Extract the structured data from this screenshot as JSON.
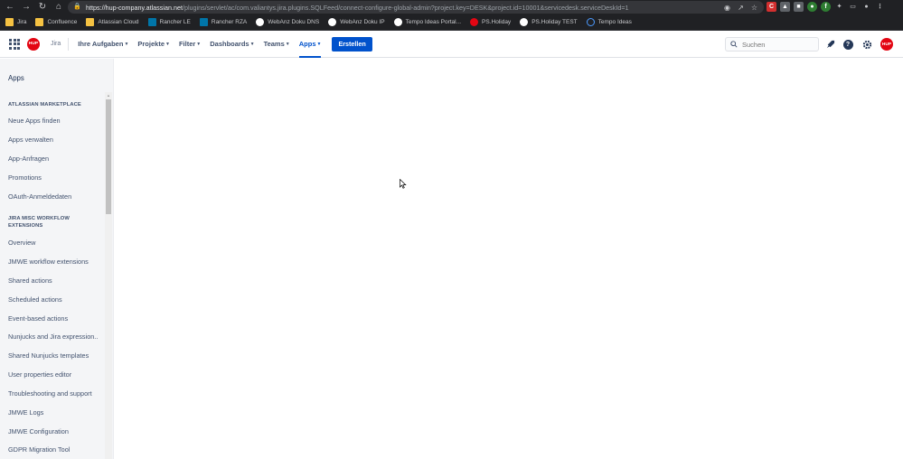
{
  "browser": {
    "url_host": "https://hup-company.atlassian.net",
    "url_path": "/plugins/servlet/ac/com.valiantys.jira.plugins.SQLFeed/connect-configure-global-admin?project.key=DESK&project.id=10001&servicedesk.serviceDeskId=1",
    "bookmarks": [
      {
        "label": "Jira",
        "icon": "folder-icon",
        "color": "#f5c242"
      },
      {
        "label": "Confluence",
        "icon": "folder-icon",
        "color": "#f5c242"
      },
      {
        "label": "Atlassian Cloud",
        "icon": "folder-icon",
        "color": "#f5c242"
      },
      {
        "label": "Rancher LE",
        "icon": "rancher-icon",
        "color": "#0075a8"
      },
      {
        "label": "Rancher RZA",
        "icon": "rancher-icon",
        "color": "#0075a8"
      },
      {
        "label": "WebAnz Doku DNS",
        "icon": "github-icon",
        "color": "#ffffff"
      },
      {
        "label": "WebAnz Doku IP",
        "icon": "github-icon",
        "color": "#ffffff"
      },
      {
        "label": "Tempo Ideas Portal...",
        "icon": "github-icon",
        "color": "#ffffff"
      },
      {
        "label": "PS.Holiday",
        "icon": "hup-icon",
        "color": "#e30613"
      },
      {
        "label": "PS.Holiday TEST",
        "icon": "github-icon",
        "color": "#ffffff"
      },
      {
        "label": "Tempo Ideas",
        "icon": "tempo-icon",
        "color": "#4c9aff"
      }
    ]
  },
  "topnav": {
    "logo_text": "HUP",
    "product": "Jira",
    "items": [
      {
        "label": "Ihre Aufgaben",
        "active": false
      },
      {
        "label": "Projekte",
        "active": false
      },
      {
        "label": "Filter",
        "active": false
      },
      {
        "label": "Dashboards",
        "active": false
      },
      {
        "label": "Teams",
        "active": false
      },
      {
        "label": "Apps",
        "active": true
      }
    ],
    "create_label": "Erstellen",
    "search_placeholder": "Suchen",
    "avatar_text": "HUP"
  },
  "sidebar": {
    "title": "Apps",
    "sections": [
      {
        "heading": "ATLASSIAN MARKETPLACE",
        "items": [
          "Neue Apps finden",
          "Apps verwalten",
          "App-Anfragen",
          "Promotions",
          "OAuth-Anmeldedaten"
        ]
      },
      {
        "heading": "JIRA MISC WORKFLOW EXTENSIONS",
        "items": [
          "Overview",
          "JMWE workflow extensions",
          "Shared actions",
          "Scheduled actions",
          "Event-based actions",
          "Nunjucks and Jira expression...",
          "Shared Nunjucks templates",
          "User properties editor",
          "Troubleshooting and support",
          "JMWE Logs",
          "JMWE Configuration",
          "GDPR Migration Tool"
        ]
      }
    ]
  },
  "colors": {
    "accent": "#0052cc",
    "brand": "#e30613",
    "sidebar_bg": "#f4f5f7"
  }
}
